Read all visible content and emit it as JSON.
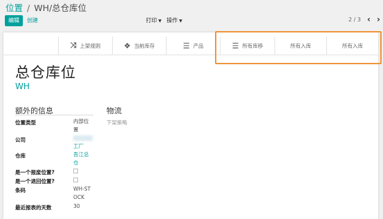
{
  "breadcrumb": {
    "parent": "位置",
    "separator": "/",
    "current": "WH/总仓库位"
  },
  "toolbar": {
    "edit_label": "编辑",
    "create_label": "创建",
    "print_label": "打印",
    "action_label": "操作",
    "pager": "2 / 3"
  },
  "smart_buttons": [
    {
      "label": "上架规则",
      "icon": "shuffle-icon"
    },
    {
      "label": "当前库存",
      "icon": "cubes-icon"
    },
    {
      "label": "产品",
      "icon": "list-icon"
    },
    {
      "label": "所有库移",
      "icon": "list-icon"
    },
    {
      "label": "所有入库",
      "icon": ""
    },
    {
      "label": "所有入库",
      "icon": ""
    }
  ],
  "record": {
    "name": "总仓库位",
    "code": "WH"
  },
  "section_extra": {
    "title": "额外的信息",
    "fields": [
      {
        "label": "位置类型",
        "value": "内部位置"
      },
      {
        "label": "公司",
        "value": "工厂"
      },
      {
        "label": "仓库",
        "value": "吾江总仓"
      },
      {
        "label": "是一个报废位置?",
        "value": ""
      },
      {
        "label": "是一个退回位置?",
        "value": ""
      },
      {
        "label": "条码",
        "value": "WH-STOCK"
      },
      {
        "label": "最近报表的天数",
        "value": "30"
      }
    ]
  },
  "section_logistics": {
    "title": "物流",
    "field_label": "下架策略"
  },
  "colors": {
    "accent": "#00A09D",
    "highlight": "#F0943A"
  }
}
